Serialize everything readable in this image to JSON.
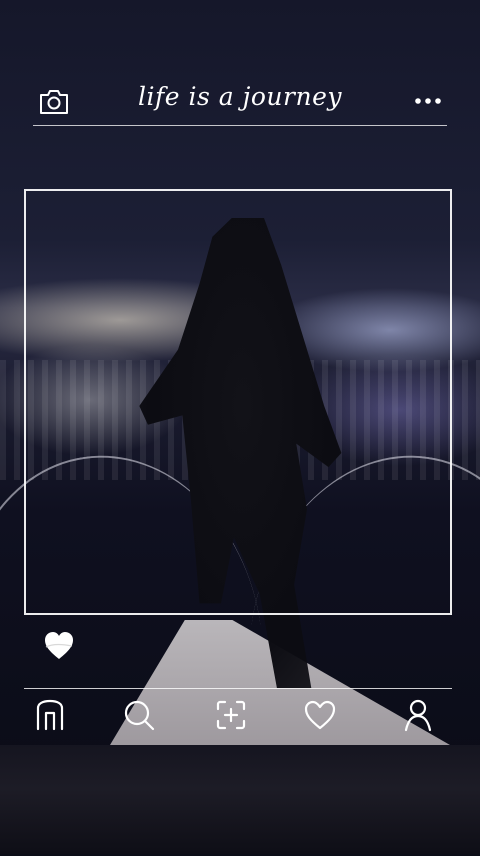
{
  "header": {
    "title": "life is a journey",
    "camera_icon": "camera-icon",
    "more_icon": "more-horizontal-icon"
  },
  "post": {
    "like_icon": "heart-filled-icon"
  },
  "nav": {
    "items": [
      {
        "icon": "home-icon"
      },
      {
        "icon": "search-icon"
      },
      {
        "icon": "add-post-icon"
      },
      {
        "icon": "heart-outline-icon"
      },
      {
        "icon": "profile-icon"
      }
    ]
  },
  "colors": {
    "overlay_line": "#ffffff",
    "background": "#0b0d17"
  }
}
